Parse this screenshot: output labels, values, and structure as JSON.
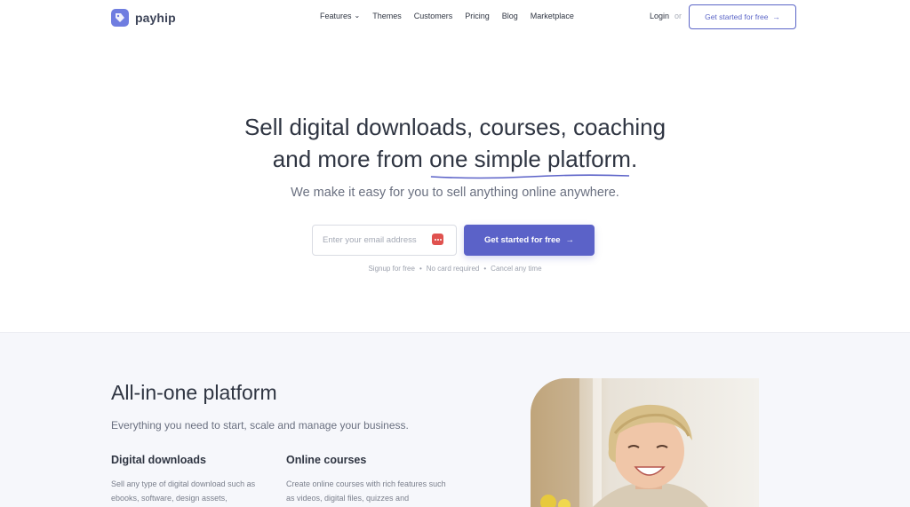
{
  "brand": {
    "name": "payhip",
    "color": "#6f7de0"
  },
  "nav": {
    "items": [
      "Features",
      "Themes",
      "Customers",
      "Pricing",
      "Blog",
      "Marketplace"
    ],
    "login": "Login",
    "or": "or",
    "cta": "Get started for free"
  },
  "hero": {
    "title_line1": "Sell digital downloads, courses, coaching",
    "title_line2_pre": "and more from ",
    "title_highlight": "one simple platform",
    "title_line2_post": ".",
    "subtitle": "We make it easy for you to sell anything online anywhere.",
    "email_placeholder": "Enter your email address",
    "cta": "Get started for free",
    "fine_print": [
      "Signup for free",
      "No card required",
      "Cancel any time"
    ]
  },
  "section2": {
    "title": "All-in-one platform",
    "subtitle": "Everything you need to start, scale and manage your business.",
    "features": [
      {
        "title": "Digital downloads",
        "text": "Sell any type of digital download such as ebooks, software, design assets,"
      },
      {
        "title": "Online courses",
        "text": "Create online courses with rich features such as videos, digital files, quizzes and"
      }
    ]
  },
  "colors": {
    "accent": "#5b62c8",
    "text": "#2f3542",
    "muted": "#6a7080",
    "section_bg": "#f6f7fb"
  }
}
